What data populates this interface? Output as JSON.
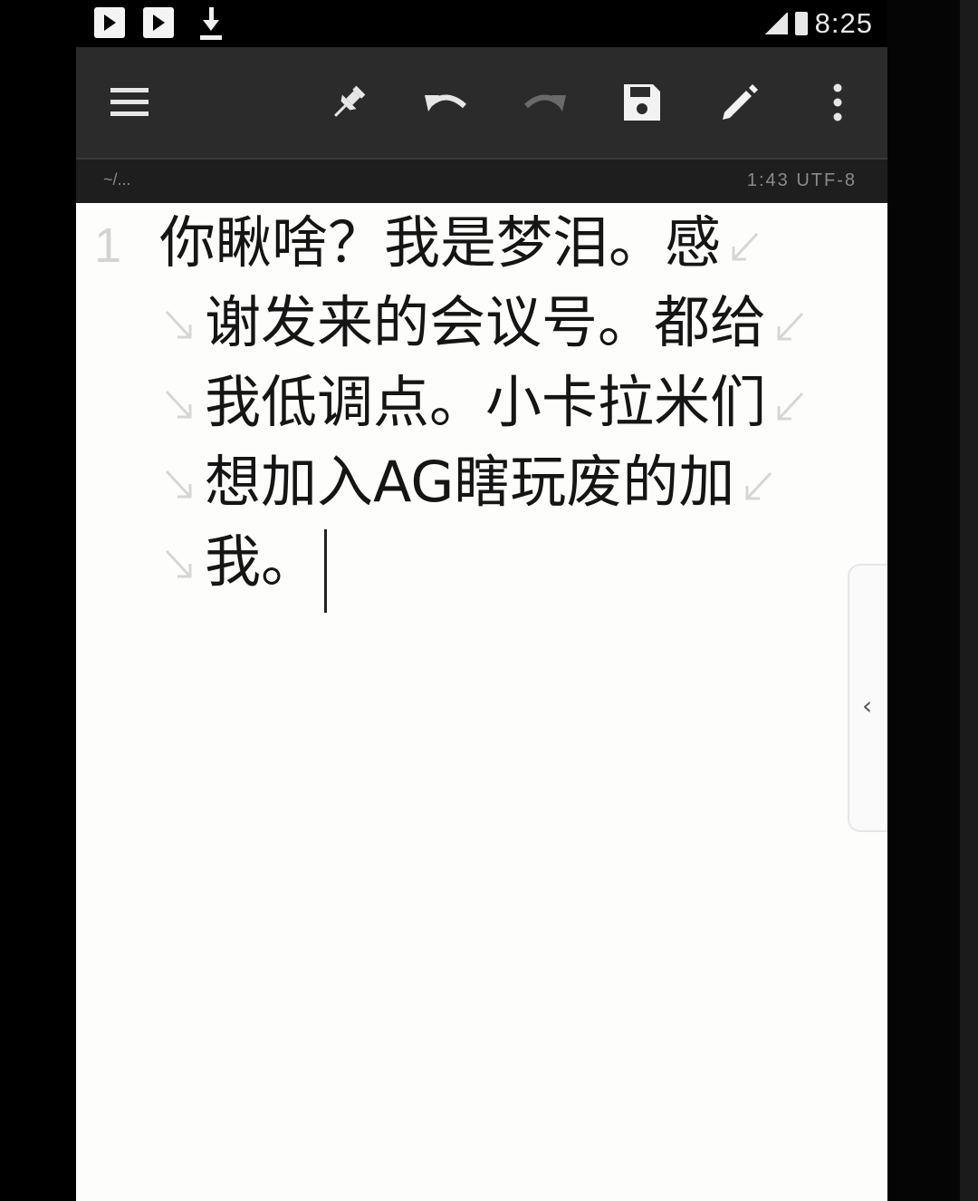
{
  "status_bar": {
    "time": "8:25",
    "icons": [
      "play-store-icon",
      "play-store-icon",
      "download-icon",
      "signal-icon",
      "battery-icon"
    ]
  },
  "toolbar": {
    "buttons": [
      "menu-icon",
      "pin-icon",
      "undo-icon",
      "redo-icon",
      "save-icon",
      "edit-icon",
      "more-vert-icon"
    ]
  },
  "info_bar": {
    "left": "~/...",
    "right": "1:43  UTF-8"
  },
  "editor": {
    "line_number": "1",
    "wrapped_lines": [
      "你瞅啥？我是梦泪。感",
      "谢发来的会议号。都给",
      "我低调点。小卡拉米们",
      "想加入AG瞎玩废的加",
      "我。"
    ]
  },
  "colors": {
    "toolbar_bg": "#2b2b2b",
    "editor_bg": "#fdfdfb",
    "text": "#151515"
  }
}
